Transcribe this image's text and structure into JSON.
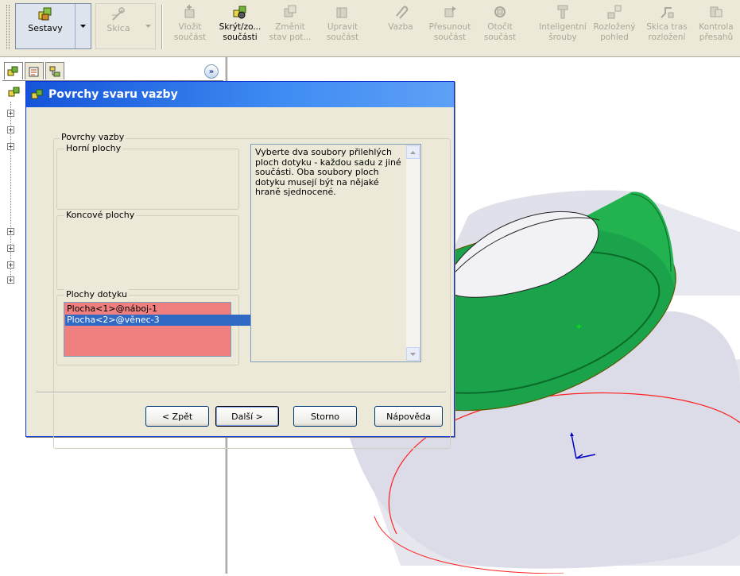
{
  "toolbar": {
    "sestavy_label": "Sestavy",
    "skica_label": "Skica",
    "buttons": [
      {
        "line1": "Vložit",
        "line2": "součást",
        "enabled": false
      },
      {
        "line1": "Skrýt/zo...",
        "line2": "součásti",
        "enabled": true
      },
      {
        "line1": "Změnit",
        "line2": "stav pot...",
        "enabled": false
      },
      {
        "line1": "Upravit",
        "line2": "součást",
        "enabled": false
      },
      {
        "line1": "Vazba",
        "line2": "",
        "enabled": false
      },
      {
        "line1": "Přesunout",
        "line2": "součást",
        "enabled": false
      },
      {
        "line1": "Otočit",
        "line2": "součást",
        "enabled": false
      },
      {
        "line1": "Inteligentní",
        "line2": "šrouby",
        "enabled": false
      },
      {
        "line1": "Rozložený",
        "line2": "pohled",
        "enabled": false
      },
      {
        "line1": "Skica tras",
        "line2": "rozložení",
        "enabled": false
      },
      {
        "line1": "Kontrola",
        "line2": "přesahů",
        "enabled": false
      }
    ]
  },
  "panel": {
    "expand_glyph": "»",
    "tabs": [
      "feature-manager-icon",
      "property-manager-icon",
      "configuration-manager-icon"
    ]
  },
  "dialog": {
    "title": "Povrchy svaru vazby",
    "group_main": "Povrchy vazby",
    "group_top": "Horní plochy",
    "group_end": "Koncové plochy",
    "group_contact": "Plochy dotyku",
    "contact_items": [
      "Plocha<1>@náboj-1",
      "Plocha<2>@věnec-3"
    ],
    "description": "Vyberte dva soubory přilehlých ploch dotyku - každou sadu z jiné součásti.  Oba soubory ploch dotyku musejí být na nějaké hraně sjednocené.",
    "buttons": {
      "back": "< Zpět",
      "next": "Další >",
      "cancel": "Storno",
      "help": "Nápověda"
    }
  },
  "colors": {
    "title_bar": "#3f8cf3",
    "selection_list": "#f08080",
    "selected_item": "#316ac5",
    "model_green": "#1aa34a",
    "model_edge_red": "#ff2020"
  }
}
